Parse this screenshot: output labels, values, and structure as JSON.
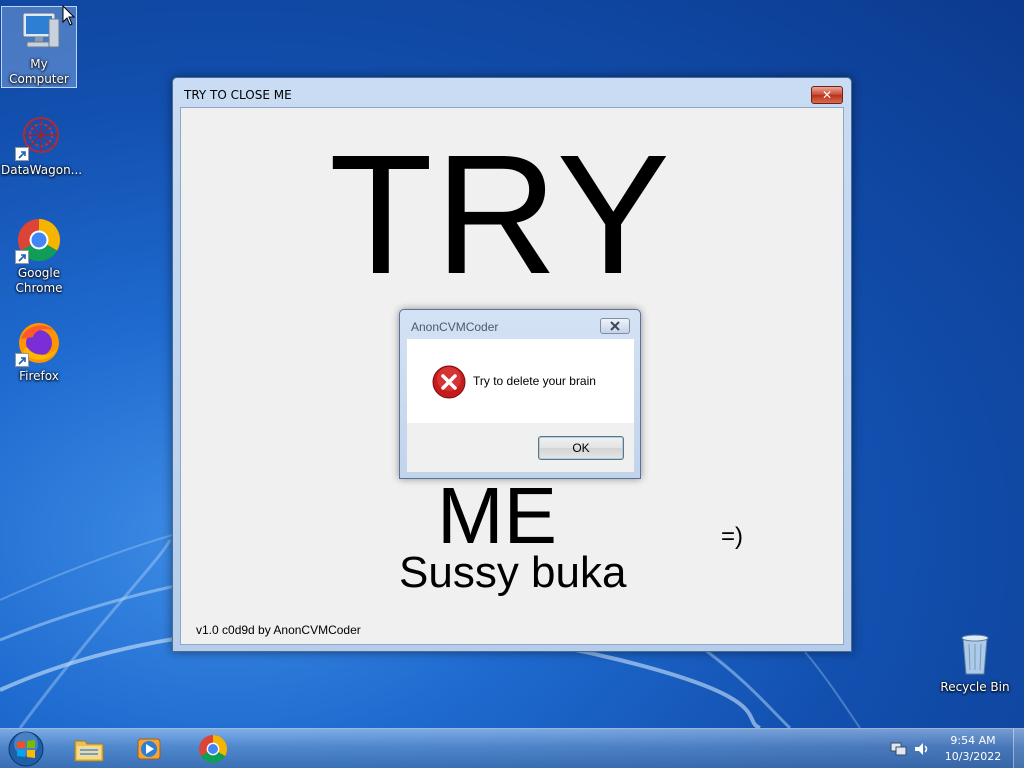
{
  "desktop": {
    "icons": [
      {
        "label": "My Computer",
        "icon": "computer-icon"
      },
      {
        "label": "DataWagon...",
        "icon": "datawagon-icon"
      },
      {
        "label": "Google Chrome",
        "icon": "chrome-icon"
      },
      {
        "label": "Firefox",
        "icon": "firefox-icon"
      },
      {
        "label": "Recycle Bin",
        "icon": "recycle-bin-icon"
      }
    ]
  },
  "main_window": {
    "title": "TRY TO CLOSE ME",
    "close_glyph": "✕",
    "big_text_top": "TRY",
    "big_text_bottom": "ME",
    "smiley": "=)",
    "subtitle": "Sussy buka",
    "version": "v1.0 c0d9d by AnonCVMCoder"
  },
  "message_box": {
    "title": "AnonCVMCoder",
    "icon": "error-icon",
    "message": "Try to delete your brain",
    "ok_label": "OK"
  },
  "taskbar": {
    "items": [
      "start-orb-icon",
      "explorer-icon",
      "media-player-icon",
      "chrome-icon"
    ],
    "clock_time": "9:54 AM",
    "clock_date": "10/3/2022"
  },
  "colors": {
    "wallpaper": "#1f6bd0",
    "window_frame": "#b5cdea",
    "close_red": "#c8462f",
    "error_red": "#d42020"
  }
}
